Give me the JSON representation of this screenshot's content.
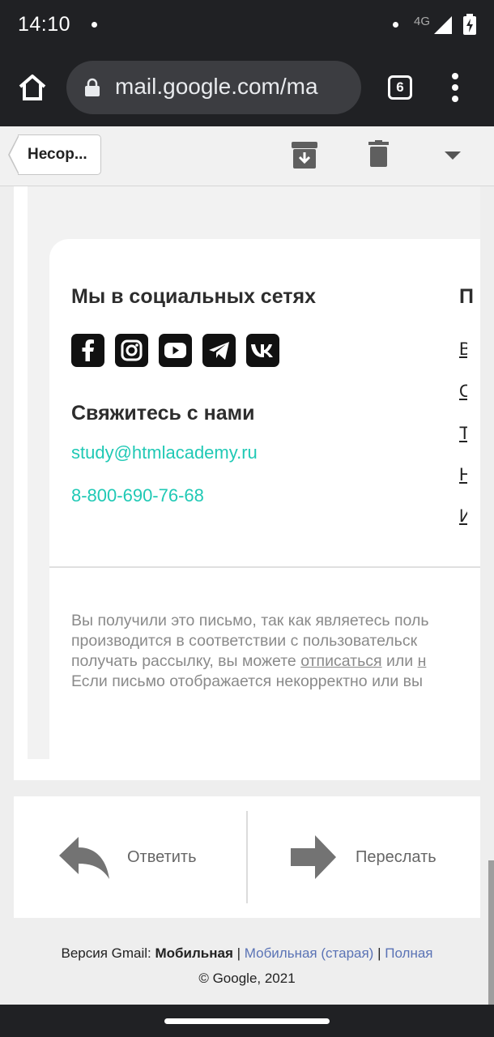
{
  "status": {
    "time": "14:10",
    "network": "4G"
  },
  "browser": {
    "url": "mail.google.com/ma",
    "tab_count": "6"
  },
  "gmail_toolbar": {
    "back_label": "Несор..."
  },
  "email": {
    "social_heading": "Мы в социальных сетях",
    "column2_heading": "П",
    "socials": [
      {
        "icon": "facebook-icon"
      },
      {
        "icon": "instagram-icon"
      },
      {
        "icon": "youtube-icon"
      },
      {
        "icon": "telegram-icon"
      },
      {
        "icon": "vk-icon"
      }
    ],
    "contact_heading": "Свяжитесь с нами",
    "contact_email": "study@htmlacademy.ru",
    "contact_phone": "8-800-690-76-68",
    "column2_links": [
      "В",
      "О",
      "Т",
      "Н",
      "И"
    ],
    "footer_line1": "Вы получили это письмо, так как являетесь поль",
    "footer_line2": "производится в соответствии с пользовательск",
    "footer_line3_start": "получать рассылку, вы можете ",
    "footer_unsubscribe": "отписаться",
    "footer_line3_mid": " или ",
    "footer_line3_end": "н",
    "footer_line4": "Если письмо отображается некорректно или вы"
  },
  "actions": {
    "reply_label": "Ответить",
    "forward_label": "Переслать"
  },
  "footer": {
    "version_prefix": "Версия Gmail: ",
    "version_current": "Мобильная",
    "separator": " | ",
    "version_old": "Мобильная (старая)",
    "version_full": "Полная",
    "copyright": "© Google, 2021"
  },
  "colors": {
    "accent_link": "#20c9b5",
    "chrome_bg": "#202124",
    "gmail_link": "#5a73b5"
  }
}
